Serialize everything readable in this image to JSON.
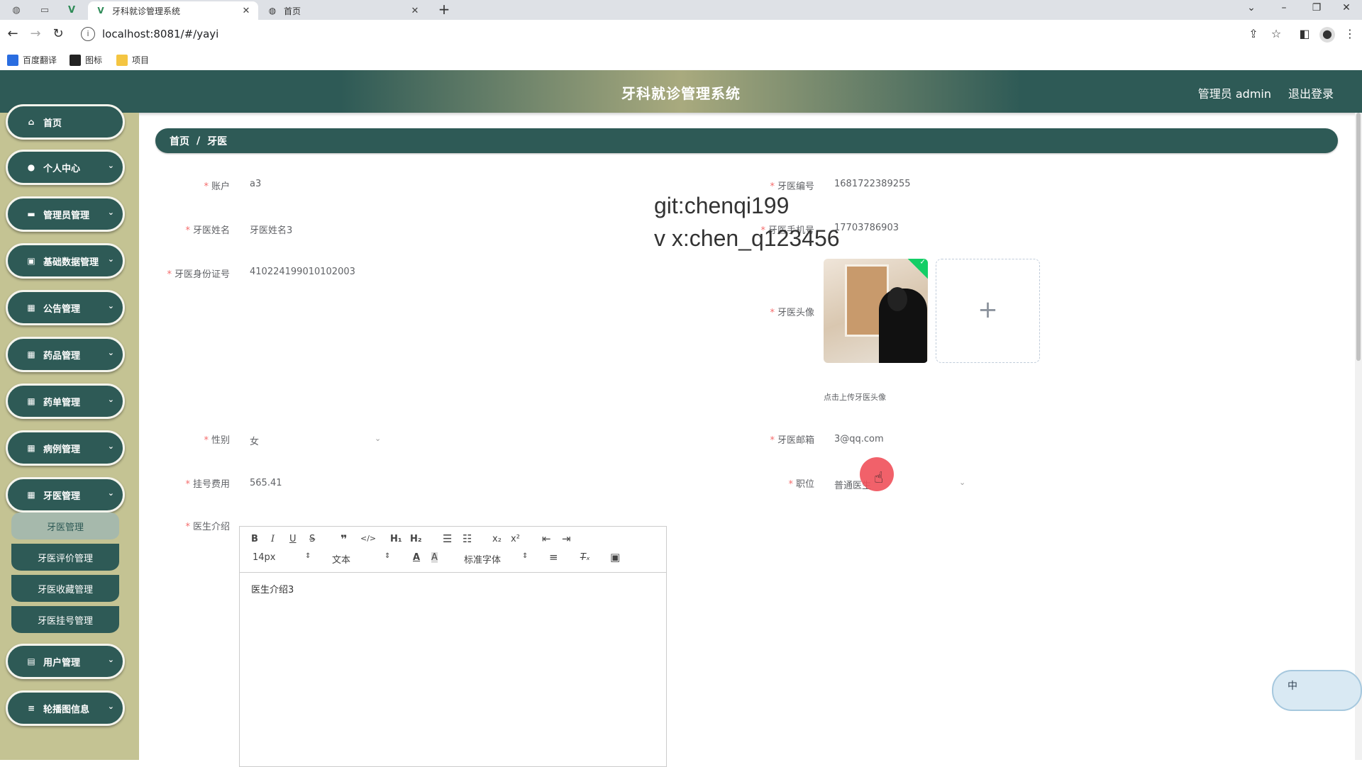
{
  "browser": {
    "tabs": [
      {
        "title": "牙科就诊管理系统",
        "icon": "vue-logo-icon",
        "active": true
      },
      {
        "title": "首页",
        "icon": "globe-icon",
        "active": false
      }
    ],
    "close_glyph": "✕",
    "newtab_glyph": "+",
    "url": "localhost:8081/#/yayi",
    "bookmarks": [
      "百度翻译",
      "图标",
      "项目"
    ]
  },
  "header": {
    "title": "牙科就诊管理系统",
    "admin": "管理员 admin",
    "logout": "退出登录"
  },
  "sidebar": {
    "items": [
      {
        "label": "首页",
        "icon": "home-icon"
      },
      {
        "label": "个人中心",
        "icon": "user-icon"
      },
      {
        "label": "管理员管理",
        "icon": "monitor-icon"
      },
      {
        "label": "基础数据管理",
        "icon": "data-icon"
      },
      {
        "label": "公告管理",
        "icon": "grid-icon"
      },
      {
        "label": "药品管理",
        "icon": "grid-icon"
      },
      {
        "label": "药单管理",
        "icon": "grid-icon"
      },
      {
        "label": "病例管理",
        "icon": "grid-icon"
      },
      {
        "label": "牙医管理",
        "icon": "grid-icon"
      },
      {
        "label": "用户管理",
        "icon": "clipboard-icon"
      },
      {
        "label": "轮播图信息",
        "icon": "menu-icon"
      }
    ],
    "submenu": [
      "牙医管理",
      "牙医评价管理",
      "牙医收藏管理",
      "牙医挂号管理"
    ]
  },
  "breadcrumb": {
    "home": "首页",
    "separator": "/",
    "current": "牙医"
  },
  "form": {
    "account": {
      "label": "账户",
      "value": "a3"
    },
    "number": {
      "label": "牙医编号",
      "value": "1681722389255"
    },
    "name": {
      "label": "牙医姓名",
      "value": "牙医姓名3"
    },
    "phone": {
      "label": "牙医手机号",
      "value": "17703786903"
    },
    "idcard": {
      "label": "牙医身份证号",
      "value": "410224199010102003"
    },
    "avatar": {
      "label": "牙医头像",
      "hint": "点击上传牙医头像",
      "plus": "+"
    },
    "gender": {
      "label": "性别",
      "value": "女"
    },
    "email": {
      "label": "牙医邮箱",
      "value": "3@qq.com"
    },
    "fee": {
      "label": "挂号费用",
      "value": "565.41"
    },
    "position": {
      "label": "职位",
      "value": "普通医生"
    },
    "intro": {
      "label": "医生介绍",
      "value": "医生介绍3"
    },
    "required_mark": "*"
  },
  "watermark": {
    "line1": "git:chenqi199",
    "line2": "v x:chen_q123456"
  },
  "editor": {
    "font_size": "14px",
    "paragraph": "文本",
    "font_family": "标准字体"
  },
  "ime": {
    "label": "中"
  }
}
